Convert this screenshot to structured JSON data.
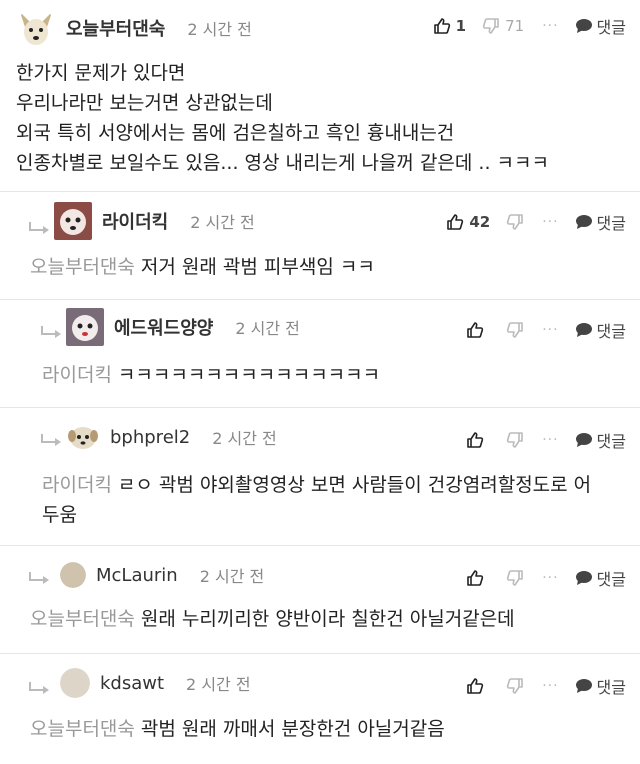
{
  "comments": [
    {
      "author": "오늘부터댄숙",
      "time": "2 시간 전",
      "likes": "1",
      "dislikes": "71",
      "more": "···",
      "reply_label": "댓글",
      "lines": [
        "한가지 문제가 있다면",
        "우리나라만 보는거면 상관없는데",
        "외국 특히 서양에서는 몸에 검은칠하고 흑인 흉내내는건",
        "인종차별로 보일수도 있음... 영상 내리는게 나을꺼 같은데 .. ㅋㅋㅋ"
      ]
    },
    {
      "author": "라이더킥",
      "time": "2 시간 전",
      "likes": "42",
      "more": "···",
      "reply_label": "댓글",
      "mention": "오늘부터댄숙",
      "lines": [
        "저거 원래 곽범 피부색임 ㅋㅋ"
      ]
    },
    {
      "author": "에드워드양양",
      "time": "2 시간 전",
      "more": "···",
      "reply_label": "댓글",
      "mention": "라이더킥",
      "lines": [
        "ㅋㅋㅋㅋㅋㅋㅋㅋㅋㅋㅋㅋㅋㅋㅋ"
      ]
    },
    {
      "author": "bphprel2",
      "time": "2 시간 전",
      "more": "···",
      "reply_label": "댓글",
      "mention": "라이더킥",
      "lines": [
        "ㄹㅇ 곽범 야외촬영영상 보면 사람들이 건강염려할정도로 어",
        "두움"
      ]
    },
    {
      "author": "McLaurin",
      "time": "2 시간 전",
      "more": "···",
      "reply_label": "댓글",
      "mention": "오늘부터댄숙",
      "lines": [
        "원래 누리끼리한 양반이라 칠한건 아닐거같은데"
      ]
    },
    {
      "author": "kdsawt",
      "time": "2 시간 전",
      "more": "···",
      "reply_label": "댓글",
      "mention": "오늘부터댄숙",
      "lines": [
        "곽범 원래 까매서 분장한건 아닐거같음"
      ]
    }
  ],
  "icons": {
    "like": "thumbs-up-icon",
    "dislike": "thumbs-down-icon",
    "reply": "speech-bubble-icon",
    "reply_indent": "reply-arrow-icon"
  },
  "colors": {
    "text": "#222222",
    "muted": "#888888",
    "mention": "#999999",
    "divider": "#e6e6e6"
  }
}
